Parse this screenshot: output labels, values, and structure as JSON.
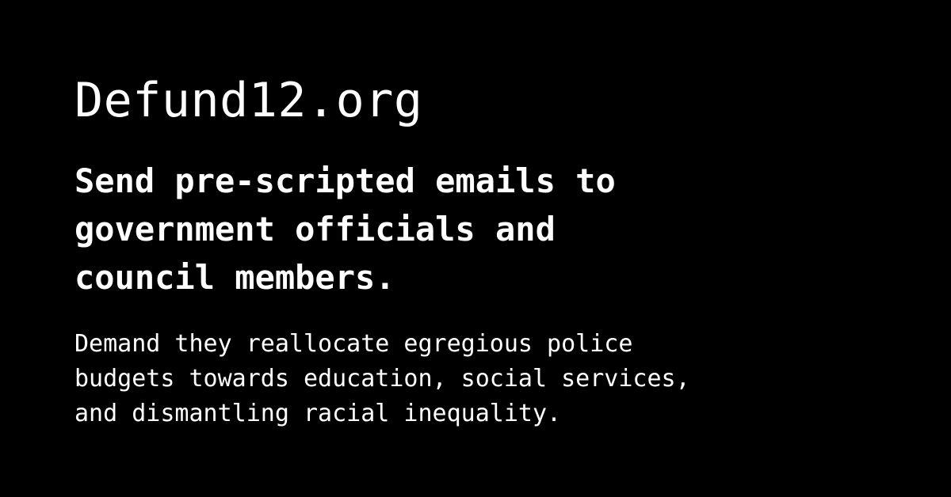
{
  "card": {
    "background_color": "#000000",
    "text_color": "#ffffff",
    "site_title": "Defund12.org",
    "headline_lines": [
      "Send pre-scripted emails to",
      "government officials and",
      "council members."
    ],
    "description_lines": [
      "Demand they reallocate egregious police",
      "budgets towards education, social services,",
      "and dismantling racial inequality."
    ]
  }
}
